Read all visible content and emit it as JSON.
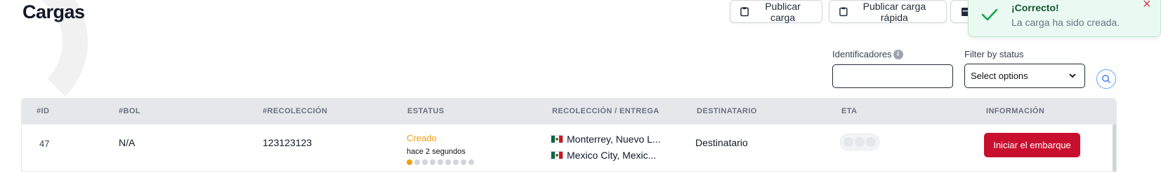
{
  "page": {
    "title": "Cargas"
  },
  "toolbar": {
    "publicar_label": "Publicar carga",
    "publicar_rapida_label": "Publicar carga rápida"
  },
  "toast": {
    "title": "¡Correcto!",
    "message": "La carga ha sido creada.",
    "close": "×",
    "color_success": "#16a34a",
    "color_close": "#dc3545"
  },
  "filters": {
    "identificadores_label": "Identificadores",
    "identificadores_value": "",
    "status_label": "Filter by status",
    "status_selected": "Select options"
  },
  "table": {
    "columns": [
      "#ID",
      "#BOL",
      "#RECOLECCIÓN",
      "ESTATUS",
      "RECOLECCIÓN / ENTREGA",
      "DESTINATARIO",
      "ETA",
      "INFORMACIÓN"
    ],
    "rows": [
      {
        "id": "47",
        "bol": "N/A",
        "recoleccion": "123123123",
        "status": "Creado",
        "status_time": "hace 2 segundos",
        "status_step": 1,
        "status_steps_total": 9,
        "pickup": "Monterrey, Nuevo L...",
        "delivery": "Mexico City, Mexic...",
        "destinatario": "Destinatario",
        "action_label": "Iniciar el embarque"
      }
    ]
  },
  "colors": {
    "accent_red": "#c8102e",
    "status_orange": "#f59e0b"
  }
}
